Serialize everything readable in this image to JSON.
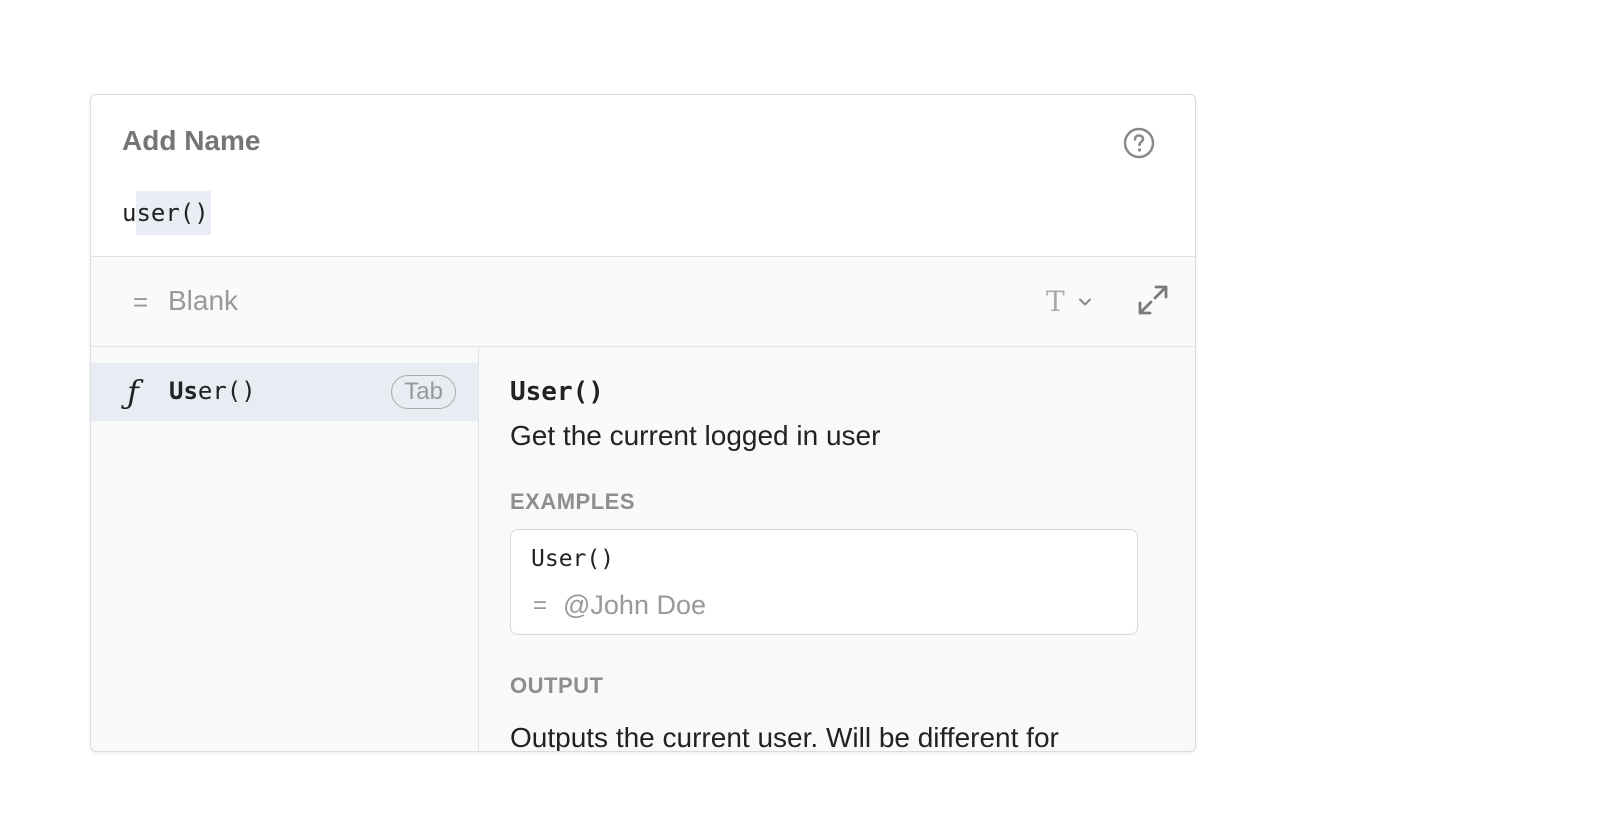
{
  "editor": {
    "name_placeholder": "Add Name",
    "formula_prefix": "u",
    "formula_highlight": "ser()",
    "help_icon": "question-circle-icon"
  },
  "result": {
    "equals": "=",
    "value": "Blank",
    "type_glyph": "T",
    "type_icon": "text-type-icon",
    "expand_icon": "expand-icon"
  },
  "suggestions": [
    {
      "icon": "function-icon",
      "icon_glyph": "ƒ",
      "match": "Us",
      "rest": "er()",
      "badge": "Tab"
    }
  ],
  "detail": {
    "title": "User()",
    "description": "Get the current logged in user",
    "examples_label": "EXAMPLES",
    "example_code": "User()",
    "example_equals": "=",
    "example_result": "@John Doe",
    "output_label": "OUTPUT",
    "output_text": "Outputs the current user. Will be different for"
  }
}
